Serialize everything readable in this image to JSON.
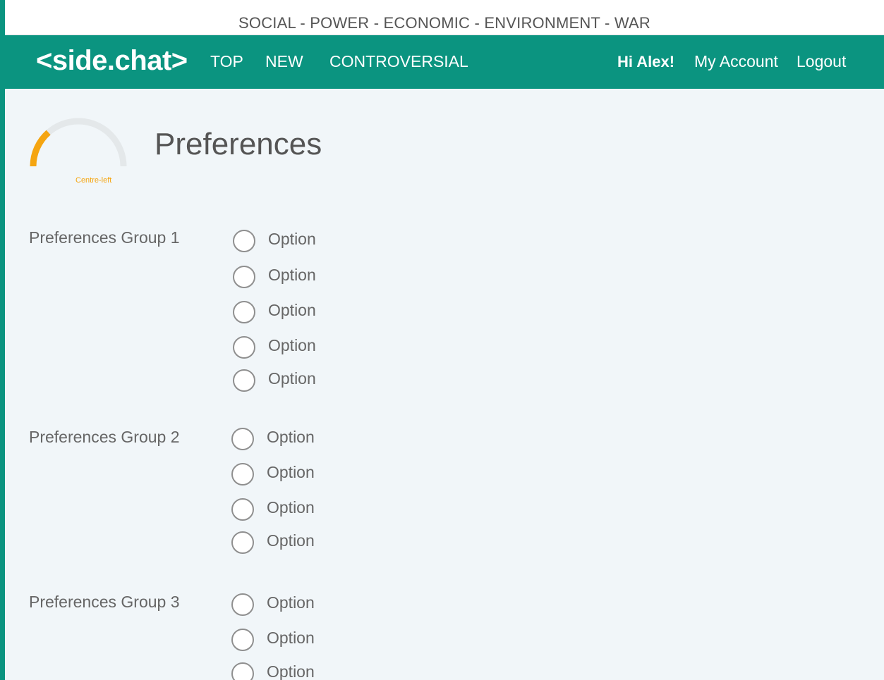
{
  "topics": {
    "items": [
      "SOCIAL",
      "POWER",
      "ECONOMIC",
      "ENVIRONMENT",
      "WAR"
    ],
    "separator": " - "
  },
  "navbar": {
    "logo": "<side.chat>",
    "links": [
      "TOP",
      "NEW",
      "CONTROVERSIAL"
    ],
    "greeting": "Hi Alex!",
    "account": "My Account",
    "logout": "Logout",
    "color": "#0b9480"
  },
  "gauge": {
    "label": "Centre-left",
    "level": 0.27,
    "color": "#f5a511"
  },
  "page": {
    "title": "Preferences"
  },
  "groups": [
    {
      "label": "Preferences Group 1",
      "options": [
        "Option",
        "Option",
        "Option",
        "Option",
        "Option"
      ]
    },
    {
      "label": "Preferences Group 2",
      "options": [
        "Option",
        "Option",
        "Option",
        "Option"
      ]
    },
    {
      "label": "Preferences Group 3",
      "options": [
        "Option",
        "Option",
        "Option"
      ]
    }
  ]
}
